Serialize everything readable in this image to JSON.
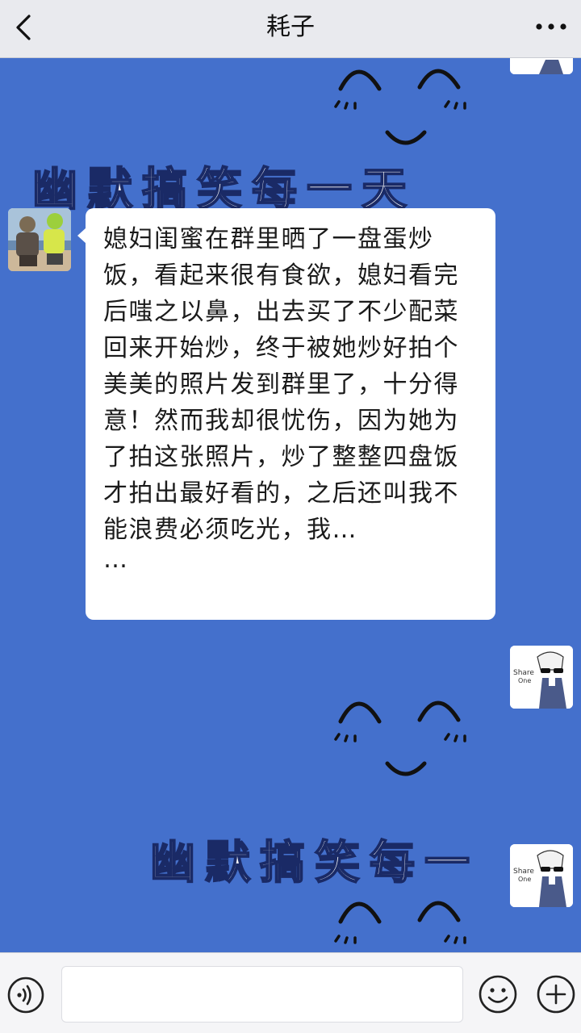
{
  "header": {
    "title": "耗子",
    "back_icon": "chevron-left-icon",
    "more_icon": "more-dots-icon"
  },
  "chat": {
    "background_color": "#4470cc",
    "banner_text": "幽默搞笑每一天",
    "banner_text_partial": "幽默搞笑每一",
    "message": {
      "text": "媳妇闺蜜在群里晒了一盘蛋炒饭，看起来很有食欲，媳妇看完后嗤之以鼻，出去买了不少配菜回来开始炒，终于被她炒好拍个美美的照片发到群里了，十分得意！然而我却很忧伤，因为她为了拍这张照片，炒了整整四盘饭才拍出最好看的，之后还叫我不能浪费必须吃光，我…",
      "trailing": "…"
    },
    "avatar_badge_1": "Share",
    "avatar_badge_2": "One"
  },
  "footer": {
    "voice_icon": "voice-icon",
    "input_value": "",
    "emoji_icon": "emoji-icon",
    "plus_icon": "plus-icon"
  }
}
